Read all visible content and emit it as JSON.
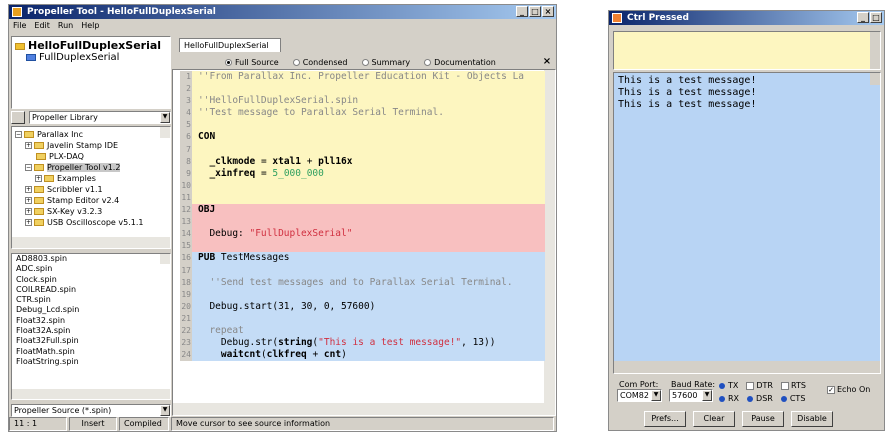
{
  "propeller": {
    "title": "Propeller Tool - HelloFullDuplexSerial",
    "menu": [
      "File",
      "Edit",
      "Run",
      "Help"
    ],
    "tree_root": "HelloFullDuplexSerial",
    "tree_child": "FullDuplexSerial",
    "library_select": "Propeller Library",
    "folders": [
      {
        "label": "Parallax Inc",
        "pm": "−",
        "indent": 0
      },
      {
        "label": "Javelin Stamp IDE",
        "pm": "+",
        "indent": 1
      },
      {
        "label": "PLX-DAQ",
        "pm": "",
        "indent": 1
      },
      {
        "label": "Propeller Tool v1.2",
        "pm": "−",
        "indent": 1
      },
      {
        "label": "Examples",
        "pm": "+",
        "indent": 2
      },
      {
        "label": "Scribbler v1.1",
        "pm": "+",
        "indent": 1
      },
      {
        "label": "Stamp Editor v2.4",
        "pm": "+",
        "indent": 1
      },
      {
        "label": "SX-Key v3.2.3",
        "pm": "+",
        "indent": 1
      },
      {
        "label": "USB Oscilloscope v5.1.1",
        "pm": "+",
        "indent": 1
      }
    ],
    "files": [
      "AD8803.spin",
      "ADC.spin",
      "Clock.spin",
      "COILREAD.spin",
      "CTR.spin",
      "Debug_Lcd.spin",
      "Float32.spin",
      "Float32A.spin",
      "Float32Full.spin",
      "FloatMath.spin",
      "FloatString.spin"
    ],
    "filter_select": "Propeller Source (*.spin)",
    "tab": "HelloFullDuplexSerial",
    "view_options": [
      "Full Source",
      "Condensed",
      "Summary",
      "Documentation"
    ],
    "code_yellow": [
      "''From Parallax Inc. Propeller Education Kit - Objects La",
      "",
      "''HelloFullDuplexSerial.spin",
      "''Test message to Parallax Serial Terminal.",
      "",
      "CON",
      "",
      "  _clkmode = xtal1 + pll16x",
      "  _xinfreq = 5_000_000",
      "",
      ""
    ],
    "code_red": [
      "OBJ",
      "",
      "  Debug: \"FullDuplexSerial\"",
      ""
    ],
    "code_blue": [
      "PUB TestMessages",
      "",
      "  ''Send test messages and to Parallax Serial Terminal.",
      "",
      "  Debug.start(31, 30, 0, 57600)",
      "",
      "  repeat",
      "    Debug.str(string(\"This is a test message!\", 13))",
      "    waitcnt(clkfreq + cnt)"
    ],
    "status": [
      "11 : 1",
      "Insert",
      "Compiled",
      "Move cursor to see source information"
    ]
  },
  "terminal": {
    "title": "Ctrl Pressed",
    "lines": [
      "This is a test message!",
      "This is a test message!",
      "This is a test message!"
    ],
    "com_port_label": "Com Port:",
    "com_port": "COM82",
    "baud_label": "Baud Rate:",
    "baud": "57600",
    "tx": "TX",
    "rx": "RX",
    "dtr": "DTR",
    "dsr": "DSR",
    "rts": "RTS",
    "cts": "CTS",
    "echo": "Echo On",
    "buttons": [
      "Prefs...",
      "Clear",
      "Pause",
      "Disable"
    ]
  }
}
